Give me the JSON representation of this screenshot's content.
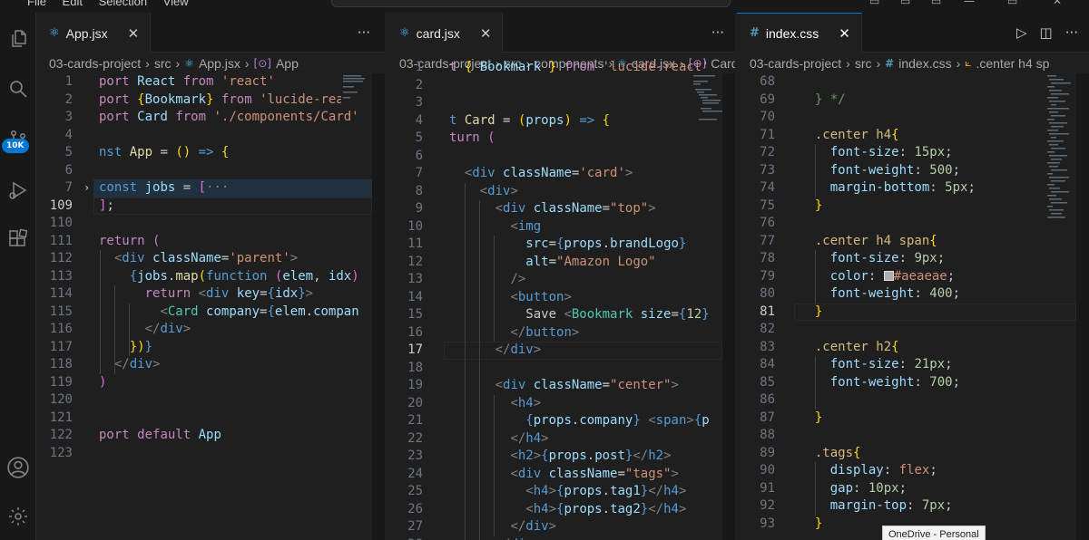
{
  "title_bar": {
    "menu": "File  Edit  Selection  View"
  },
  "activity_bar": {
    "source_control_badge": "10K"
  },
  "panes": [
    {
      "tab": {
        "icon": "⚛",
        "icon_color": "#4fc1ff",
        "name": "App.jsx",
        "close": "✕"
      },
      "actions": [
        "···"
      ],
      "breadcrumb": [
        "03-cards-project",
        "src",
        "App.jsx",
        "App"
      ],
      "lines": [
        {
          "n": "1",
          "h": "<span class=\"c\">port</span> <span class=\"v\">React</span> <span class=\"c\">from</span> <span class=\"s\">'react'</span>"
        },
        {
          "n": "2",
          "h": "<span class=\"c\">port</span> <span class=\"y\">{</span><span class=\"v\">Bookmark</span><span class=\"y\">}</span> <span class=\"c\">from</span> <span class=\"s\">'lucide-react'</span>"
        },
        {
          "n": "3",
          "h": "<span class=\"c\">port</span> <span class=\"v\">Card</span> <span class=\"c\">from</span> <span class=\"s\">'./components/Card'</span>"
        },
        {
          "n": "4",
          "h": ""
        },
        {
          "n": "5",
          "h": "<span class=\"k\">nst</span> <span class=\"f\">App</span> = <span class=\"y\">()</span> <span class=\"k\">=&gt;</span> <span class=\"y\">{</span>"
        },
        {
          "n": "6",
          "h": ""
        },
        {
          "n": "7",
          "h": "<span class=\"k\">const</span> <span class=\"v\">jobs</span> = <span class=\"p\">[</span><span class=\"tg\">···</span>",
          "fold": "›"
        },
        {
          "n": "109",
          "h": "<span class=\"p\">]</span>;",
          "cur": true
        },
        {
          "n": "110",
          "h": ""
        },
        {
          "n": "111",
          "h": "<span class=\"c\">return</span> <span class=\"p\">(</span>"
        },
        {
          "n": "112",
          "h": "  <span class=\"tg\">&lt;</span><span class=\"k\">div</span> <span class=\"v\">className</span>=<span class=\"s\">'parent'</span><span class=\"tg\">&gt;</span>"
        },
        {
          "n": "113",
          "h": "    <span class=\"k\">{</span><span class=\"v\">jobs</span>.<span class=\"f\">map</span><span class=\"y\">(</span><span class=\"k\">function</span> <span class=\"p\">(</span><span class=\"v\">elem</span>, <span class=\"v\">idx</span><span class=\"p\">)</span>"
        },
        {
          "n": "114",
          "h": "      <span class=\"c\">return</span> <span class=\"tg\">&lt;</span><span class=\"k\">div</span> <span class=\"v\">key</span>=<span class=\"k\">{</span><span class=\"v\">idx</span><span class=\"k\">}</span><span class=\"tg\">&gt;</span>"
        },
        {
          "n": "115",
          "h": "        <span class=\"tg\">&lt;</span><span class=\"t\">Card</span> <span class=\"v\">company</span>=<span class=\"k\">{</span><span class=\"v\">elem</span>.<span class=\"v\">compan</span>"
        },
        {
          "n": "116",
          "h": "      <span class=\"tg\">&lt;/</span><span class=\"k\">div</span><span class=\"tg\">&gt;</span>"
        },
        {
          "n": "117",
          "h": "    <span class=\"y\">})</span><span class=\"k\">}</span>"
        },
        {
          "n": "118",
          "h": "  <span class=\"tg\">&lt;/</span><span class=\"k\">div</span><span class=\"tg\">&gt;</span>"
        },
        {
          "n": "119",
          "h": "<span class=\"p\">)</span>"
        },
        {
          "n": "120",
          "h": ""
        },
        {
          "n": "121",
          "h": ""
        },
        {
          "n": "122",
          "h": "<span class=\"c\">port</span> <span class=\"c\">default</span> <span class=\"v\">App</span>"
        },
        {
          "n": "123",
          "h": ""
        }
      ]
    },
    {
      "tab": {
        "icon": "⚛",
        "icon_color": "#4fc1ff",
        "name": "card.jsx",
        "close": "✕"
      },
      "actions": [
        "···"
      ],
      "breadcrumb": [
        "03-cards-project",
        "src",
        "components",
        "card.jsx",
        "Card"
      ],
      "lines": [
        {
          "n": "1",
          "h": "<span class=\"c\">t</span> <span class=\"y\">{</span> <span class=\"v\">Bookmark</span> <span class=\"y\">}</span> <span class=\"c\">from</span> <span class=\"s\">'lucide-react'</span>"
        },
        {
          "n": "2",
          "h": ""
        },
        {
          "n": "3",
          "h": ""
        },
        {
          "n": "4",
          "h": "<span class=\"k\">t</span> <span class=\"f\">Card</span> = <span class=\"y\">(</span><span class=\"v\">props</span><span class=\"y\">)</span> <span class=\"k\">=&gt;</span> <span class=\"y\">{</span>"
        },
        {
          "n": "5",
          "h": "<span class=\"c\">turn</span> <span class=\"p\">(</span>"
        },
        {
          "n": "6",
          "h": ""
        },
        {
          "n": "7",
          "h": "  <span class=\"tg\">&lt;</span><span class=\"k\">div</span> <span class=\"v\">className</span>=<span class=\"s\">'card'</span><span class=\"tg\">&gt;</span>"
        },
        {
          "n": "8",
          "h": "    <span class=\"tg\">&lt;</span><span class=\"k\">div</span><span class=\"tg\">&gt;</span>"
        },
        {
          "n": "9",
          "h": "      <span class=\"tg\">&lt;</span><span class=\"k\">div</span> <span class=\"v\">className</span>=<span class=\"s\">\"top\"</span><span class=\"tg\">&gt;</span>"
        },
        {
          "n": "10",
          "h": "        <span class=\"tg\">&lt;</span><span class=\"k\">img</span>"
        },
        {
          "n": "11",
          "h": "          <span class=\"v\">src</span>=<span class=\"k\">{</span><span class=\"v\">props</span>.<span class=\"v\">brandLogo</span><span class=\"k\">}</span>"
        },
        {
          "n": "12",
          "h": "          <span class=\"v\">alt</span>=<span class=\"s\">\"Amazon Logo\"</span>"
        },
        {
          "n": "13",
          "h": "        <span class=\"tg\">/&gt;</span>"
        },
        {
          "n": "14",
          "h": "        <span class=\"tg\">&lt;</span><span class=\"k\">button</span><span class=\"tg\">&gt;</span>"
        },
        {
          "n": "15",
          "h": "          Save <span class=\"tg\">&lt;</span><span class=\"t\">Bookmark</span> <span class=\"v\">size</span>=<span class=\"k\">{</span><span class=\"n\">12</span><span class=\"k\">}</span>"
        },
        {
          "n": "16",
          "h": "        <span class=\"tg\">&lt;/</span><span class=\"k\">button</span><span class=\"tg\">&gt;</span>"
        },
        {
          "n": "17",
          "h": "      <span class=\"tg\">&lt;/</span><span class=\"k\">div</span><span class=\"tg\">&gt;</span>",
          "cur": true
        },
        {
          "n": "18",
          "h": ""
        },
        {
          "n": "19",
          "h": "      <span class=\"tg\">&lt;</span><span class=\"k\">div</span> <span class=\"v\">className</span>=<span class=\"s\">\"center\"</span><span class=\"tg\">&gt;</span>"
        },
        {
          "n": "20",
          "h": "        <span class=\"tg\">&lt;</span><span class=\"k\">h4</span><span class=\"tg\">&gt;</span>"
        },
        {
          "n": "21",
          "h": "          <span class=\"k\">{</span><span class=\"v\">props</span>.<span class=\"v\">company</span><span class=\"k\">}</span> <span class=\"tg\">&lt;</span><span class=\"k\">span</span><span class=\"tg\">&gt;</span><span class=\"k\">{</span><span class=\"v\">p</span>"
        },
        {
          "n": "22",
          "h": "        <span class=\"tg\">&lt;/</span><span class=\"k\">h4</span><span class=\"tg\">&gt;</span>"
        },
        {
          "n": "23",
          "h": "        <span class=\"tg\">&lt;</span><span class=\"k\">h2</span><span class=\"tg\">&gt;</span><span class=\"k\">{</span><span class=\"v\">props</span>.<span class=\"v\">post</span><span class=\"k\">}</span><span class=\"tg\">&lt;/</span><span class=\"k\">h2</span><span class=\"tg\">&gt;</span>"
        },
        {
          "n": "24",
          "h": "        <span class=\"tg\">&lt;</span><span class=\"k\">div</span> <span class=\"v\">className</span>=<span class=\"s\">\"tags\"</span><span class=\"tg\">&gt;</span>"
        },
        {
          "n": "25",
          "h": "          <span class=\"tg\">&lt;</span><span class=\"k\">h4</span><span class=\"tg\">&gt;</span><span class=\"k\">{</span><span class=\"v\">props</span>.<span class=\"v\">tag1</span><span class=\"k\">}</span><span class=\"tg\">&lt;/</span><span class=\"k\">h4</span><span class=\"tg\">&gt;</span>"
        },
        {
          "n": "26",
          "h": "          <span class=\"tg\">&lt;</span><span class=\"k\">h4</span><span class=\"tg\">&gt;</span><span class=\"k\">{</span><span class=\"v\">props</span>.<span class=\"v\">tag2</span><span class=\"k\">}</span><span class=\"tg\">&lt;/</span><span class=\"k\">h4</span><span class=\"tg\">&gt;</span>"
        },
        {
          "n": "27",
          "h": "        <span class=\"tg\">&lt;/</span><span class=\"k\">div</span><span class=\"tg\">&gt;</span>"
        },
        {
          "n": "28",
          "h": "      <span class=\"tg\">&lt;/</span><span class=\"k\">div</span><span class=\"tg\">&gt;</span>"
        }
      ]
    },
    {
      "tab": {
        "icon": "#",
        "icon_color": "#519aba",
        "name": "index.css",
        "close": "✕"
      },
      "actions": [
        "▷",
        "◫",
        "···"
      ],
      "breadcrumb": [
        "03-cards-project",
        "src",
        "index.css",
        ".center h4 sp"
      ],
      "lines": [
        {
          "n": "68",
          "h": ""
        },
        {
          "n": "69",
          "h": "  <span class=\"cm\">} */</span>"
        },
        {
          "n": "70",
          "h": ""
        },
        {
          "n": "71",
          "h": "  <span class=\"sel\">.center h4</span><span class=\"y\">{</span>"
        },
        {
          "n": "72",
          "h": "    <span class=\"pr\">font-size</span>: <span class=\"n\">15px</span>;"
        },
        {
          "n": "73",
          "h": "    <span class=\"pr\">font-weight</span>: <span class=\"n\">500</span>;"
        },
        {
          "n": "74",
          "h": "    <span class=\"pr\">margin-bottom</span>: <span class=\"n\">5px</span>;"
        },
        {
          "n": "75",
          "h": "  <span class=\"y\">}</span>"
        },
        {
          "n": "76",
          "h": ""
        },
        {
          "n": "77",
          "h": "  <span class=\"sel\">.center h4 span</span><span class=\"y\">{</span>"
        },
        {
          "n": "78",
          "h": "    <span class=\"pr\">font-size</span>: <span class=\"n\">9px</span>;"
        },
        {
          "n": "79",
          "h": "    <span class=\"pr\">color</span>: <span style=\"display:inline-block;width:11px;height:11px;background:#aeaeae;border:1px solid #ddd;vertical-align:-1px\"></span><span class=\"val\">#aeaeae</span>;"
        },
        {
          "n": "80",
          "h": "    <span class=\"pr\">font-weight</span>: <span class=\"n\">400</span>;"
        },
        {
          "n": "81",
          "h": "  <span class=\"y\">}</span>",
          "cur": true
        },
        {
          "n": "82",
          "h": ""
        },
        {
          "n": "83",
          "h": "  <span class=\"sel\">.center h2</span><span class=\"y\">{</span>"
        },
        {
          "n": "84",
          "h": "    <span class=\"pr\">font-size</span>: <span class=\"n\">21px</span>;"
        },
        {
          "n": "85",
          "h": "    <span class=\"pr\">font-weight</span>: <span class=\"n\">700</span>;"
        },
        {
          "n": "86",
          "h": ""
        },
        {
          "n": "87",
          "h": "  <span class=\"y\">}</span>"
        },
        {
          "n": "88",
          "h": ""
        },
        {
          "n": "89",
          "h": "  <span class=\"sel\">.tags</span><span class=\"y\">{</span>"
        },
        {
          "n": "90",
          "h": "    <span class=\"pr\">display</span>: <span class=\"val\">flex</span>;"
        },
        {
          "n": "91",
          "h": "    <span class=\"pr\">gap</span>: <span class=\"n\">10px</span>;"
        },
        {
          "n": "92",
          "h": "    <span class=\"pr\">margin-top</span>: <span class=\"n\">7px</span>;"
        },
        {
          "n": "93",
          "h": "  <span class=\"y\">}</span>"
        }
      ]
    }
  ],
  "tooltip": {
    "text": "OneDrive - Personal"
  }
}
